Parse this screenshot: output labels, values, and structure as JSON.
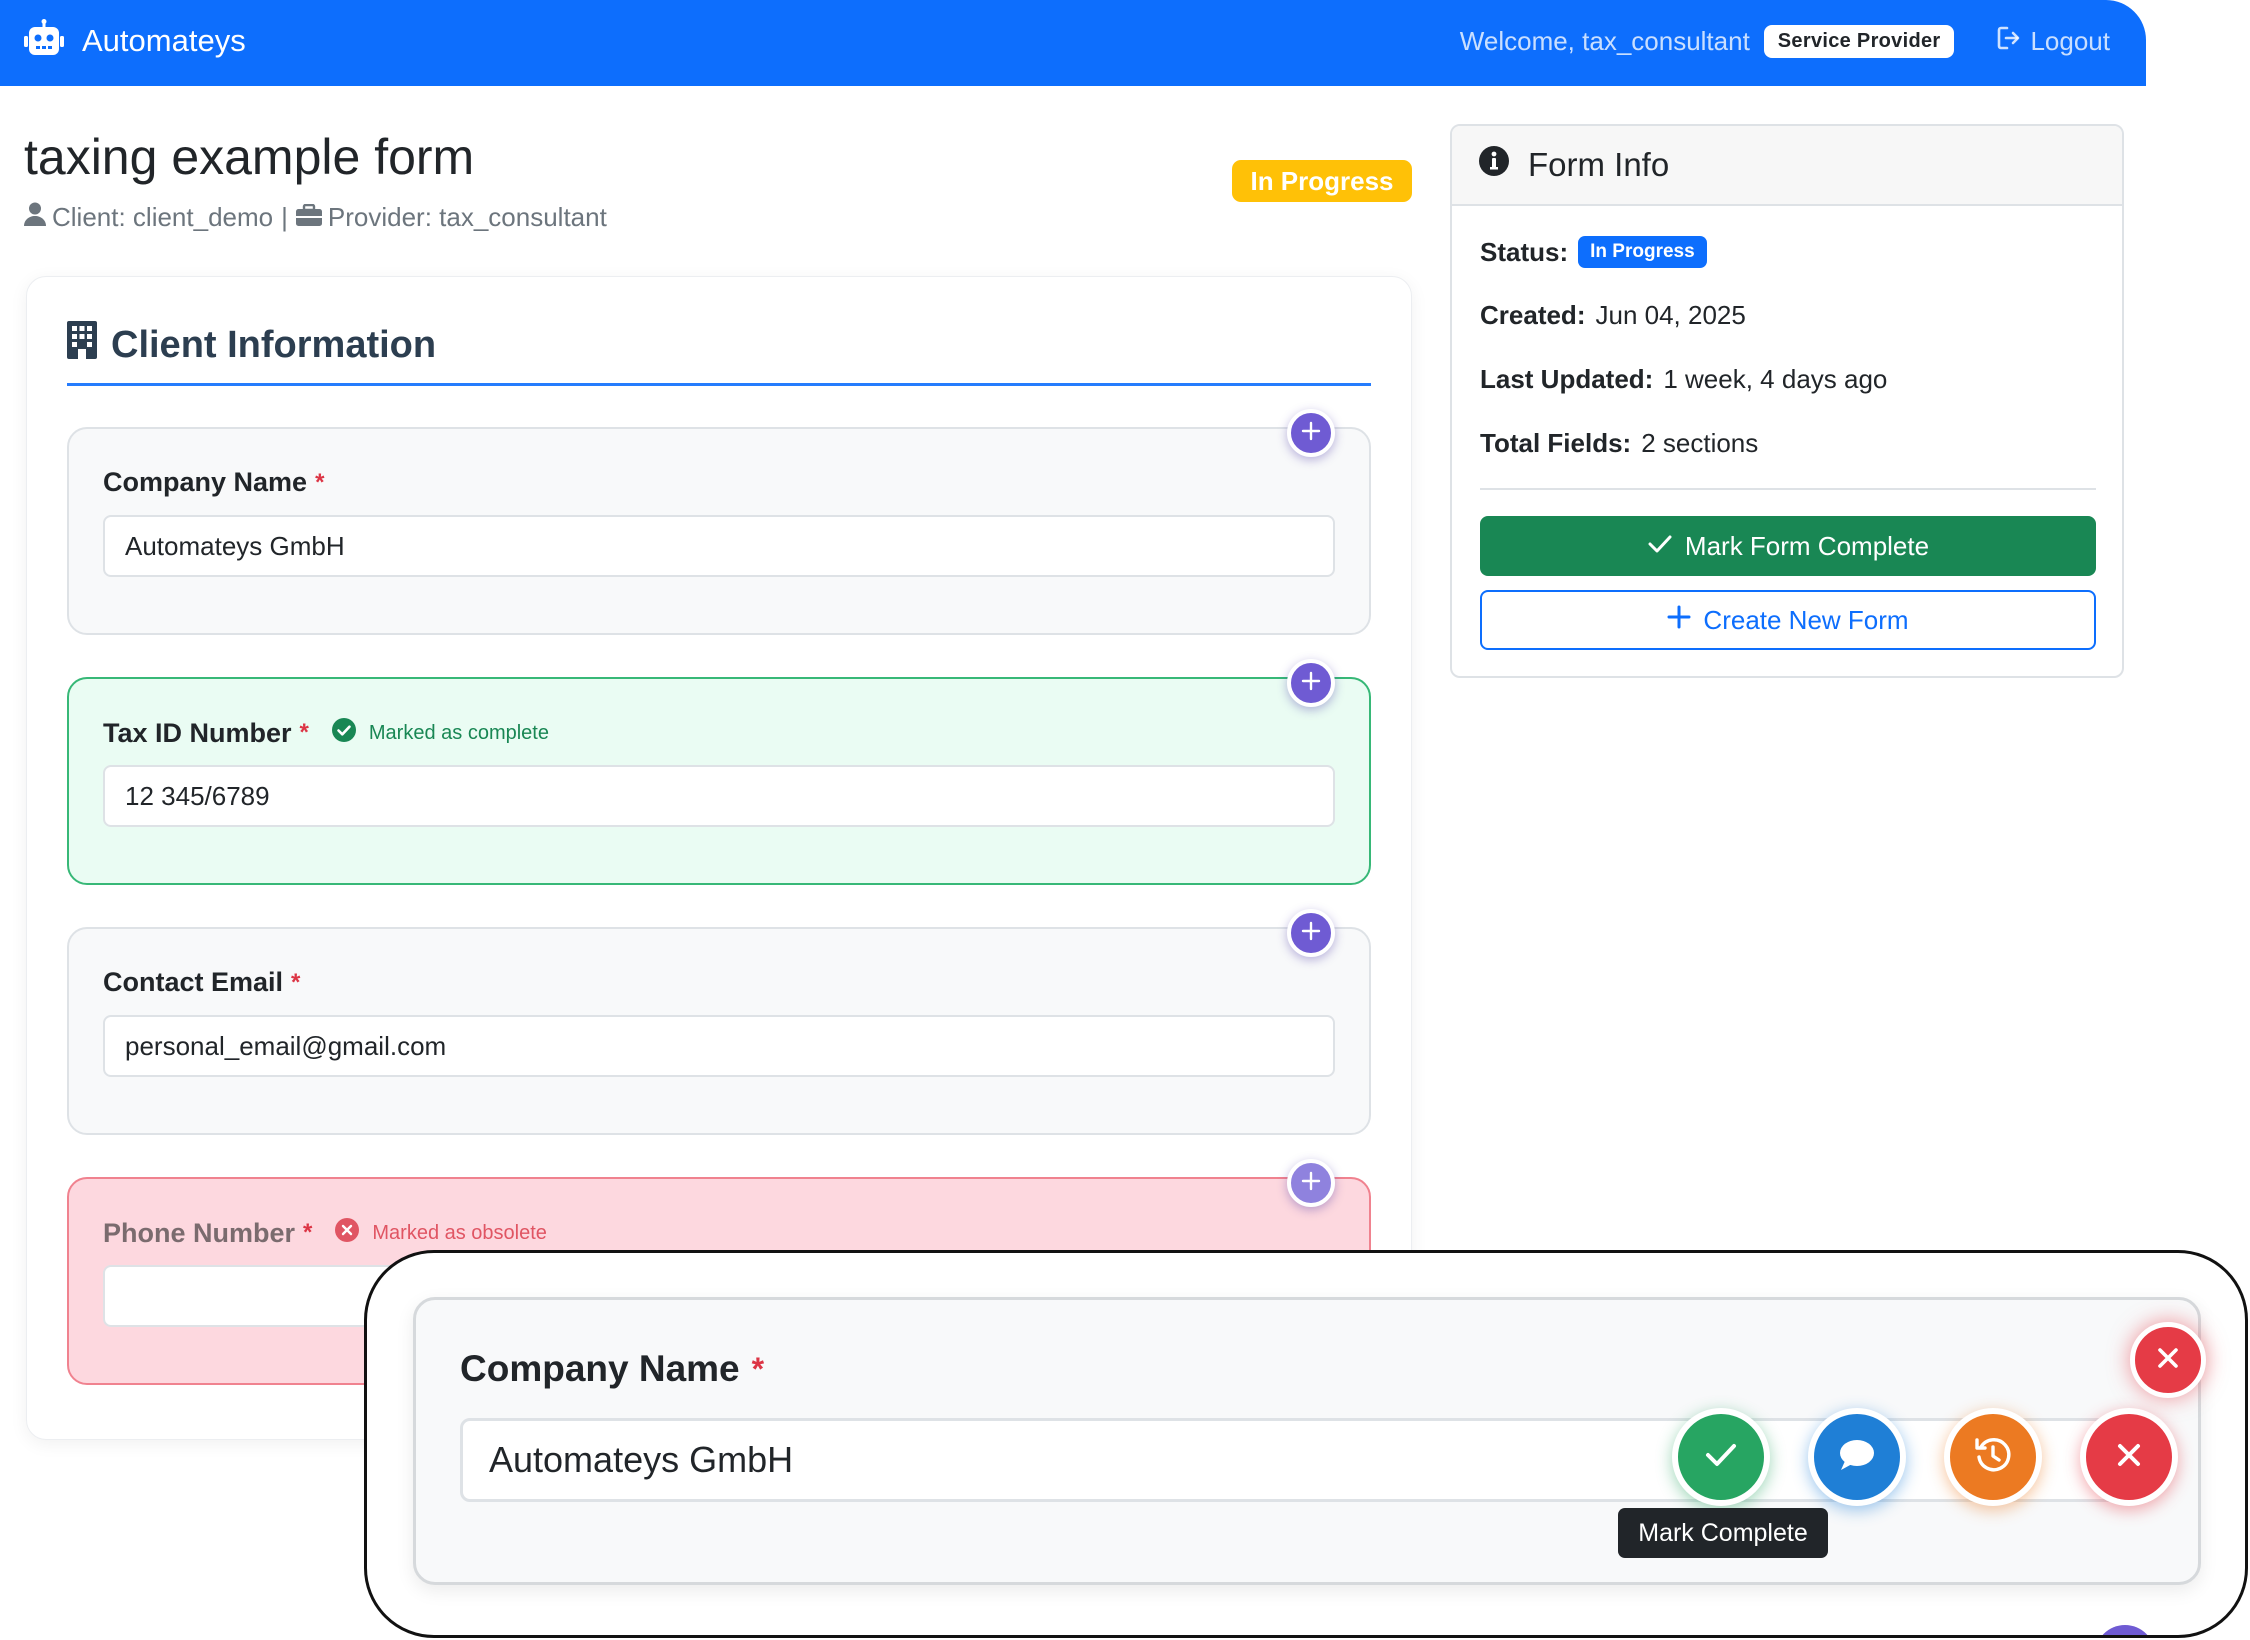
{
  "navbar": {
    "brand": "Automateys",
    "welcome": "Welcome, tax_consultant",
    "role": "Service Provider",
    "logout": "Logout",
    "icons": {
      "brand": "robot-icon",
      "logout": "sign-out-icon"
    },
    "color": "#0d6efd"
  },
  "header": {
    "title": "taxing example form",
    "client_label": "Client: client_demo",
    "separator": "|",
    "provider_label": "Provider: tax_consultant",
    "status": "In Progress",
    "status_color": "#ffc107"
  },
  "section": {
    "title": "Client Information",
    "icon": "building-icon",
    "fields": [
      {
        "label": "Company Name",
        "required": "*",
        "value": "Automateys GmbH",
        "state": "default"
      },
      {
        "label": "Tax ID Number",
        "required": "*",
        "value": "12 345/6789",
        "state": "complete",
        "note": "Marked as complete"
      },
      {
        "label": "Contact Email",
        "required": "*",
        "value": "personal_email@gmail.com",
        "state": "default"
      },
      {
        "label": "Phone Number",
        "required": "*",
        "value": "",
        "state": "obsolete",
        "note": "Marked as obsolete"
      }
    ]
  },
  "form_info": {
    "title": "Form Info",
    "status_label": "Status:",
    "status_value": "In Progress",
    "created_label": "Created:",
    "created_value": "Jun 04, 2025",
    "updated_label": "Last Updated:",
    "updated_value": "1 week, 4 days ago",
    "fields_label": "Total Fields:",
    "fields_value": "2 sections",
    "mark_complete": "Mark Form Complete",
    "create_new": "Create New Form",
    "colors": {
      "complete": "#198754",
      "new": "#0d6efd"
    }
  },
  "callout": {
    "label": "Company Name",
    "required": "*",
    "value": "Automateys GmbH",
    "tooltip": "Mark Complete",
    "actions": [
      "check-icon",
      "comment-icon",
      "history-icon",
      "close-icon"
    ],
    "colors": {
      "check": "#27a562",
      "comment": "#1f7fd6",
      "history": "#ec7a22",
      "close": "#e53b46"
    }
  }
}
